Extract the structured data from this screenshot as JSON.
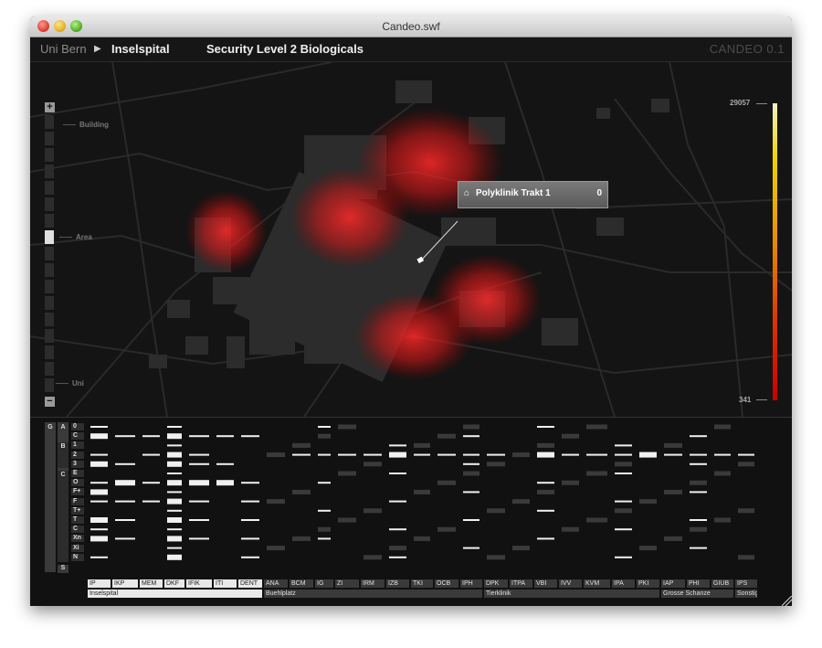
{
  "window": {
    "title": "Candeo.swf"
  },
  "header": {
    "breadcrumb_root": "Uni Bern",
    "breadcrumb_arrow": "▶",
    "breadcrumb_current": "Inselspital",
    "title": "Security Level 2 Biologicals",
    "brand": "CANDEO 0.1"
  },
  "zoom": {
    "plus": "+",
    "minus": "−",
    "labels": {
      "building": "Building",
      "area": "Area",
      "uni": "Uni"
    },
    "level": "Area"
  },
  "legend": {
    "max": "29057",
    "min": "341",
    "colors": [
      "#f5f0c8",
      "#f0d400",
      "#e89000",
      "#d83000",
      "#c80000"
    ]
  },
  "tooltip": {
    "icon": "home-icon",
    "name": "Polyklinik Trakt 1",
    "value": "0"
  },
  "matrix": {
    "cat_g": "G",
    "cat_a": "A",
    "cat_b": "B",
    "cat_c": "C",
    "cat_s": "S",
    "rows": [
      "0",
      "C",
      "1",
      "2",
      "3",
      "E",
      "O",
      "F+",
      "F",
      "T+",
      "T",
      "C",
      "Xn",
      "Xi",
      "N"
    ]
  },
  "departments": [
    "IP",
    "IKP",
    "MEM",
    "DKF",
    "IFIK",
    "ITI",
    "DENT",
    "ANA",
    "BCM",
    "IG",
    "ZI",
    "IRM",
    "IZB",
    "TKI",
    "OCB",
    "IPH",
    "DPK",
    "ITPA",
    "VBI",
    "IVV",
    "KVM",
    "IPA",
    "PKI",
    "IAP",
    "PHI",
    "GIUB",
    "IPS"
  ],
  "sites": [
    "Inselspital",
    "Buehlplatz",
    "Tierklinik",
    "Grosse Schanze",
    "Sonstige"
  ]
}
